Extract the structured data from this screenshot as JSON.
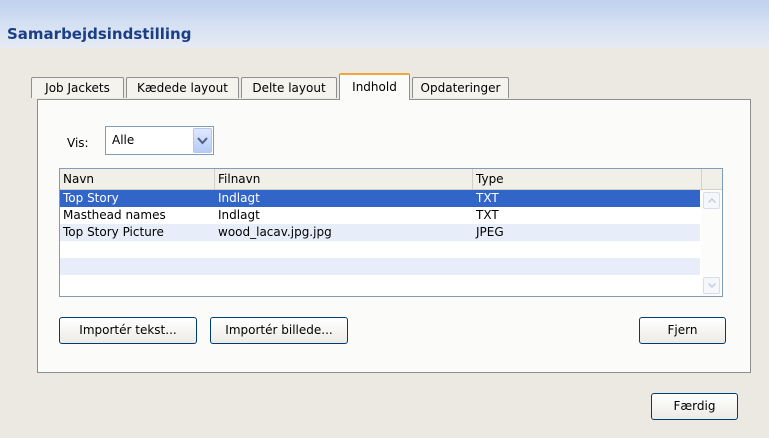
{
  "window": {
    "title": "Samarbejdsindstilling"
  },
  "tabs": [
    {
      "label": "Job Jackets",
      "active": false
    },
    {
      "label": "Kædede layout",
      "active": false
    },
    {
      "label": "Delte layout",
      "active": false
    },
    {
      "label": "Indhold",
      "active": true
    },
    {
      "label": "Opdateringer",
      "active": false
    }
  ],
  "filter": {
    "label": "Vis:",
    "selected": "Alle",
    "icon": "chevron-down-icon"
  },
  "table": {
    "columns": [
      "Navn",
      "Filnavn",
      "Type"
    ],
    "rows": [
      {
        "navn": "Top Story",
        "filnavn": "Indlagt",
        "type": "TXT",
        "selected": true
      },
      {
        "navn": "Masthead names",
        "filnavn": "Indlagt",
        "type": "TXT",
        "selected": false
      },
      {
        "navn": "Top Story Picture",
        "filnavn": "wood_lacav.jpg.jpg",
        "type": "JPEG",
        "selected": false
      }
    ]
  },
  "buttons": {
    "import_text": "Importér tekst...",
    "import_picture": "Importér billede...",
    "remove": "Fjern",
    "done": "Færdig"
  }
}
